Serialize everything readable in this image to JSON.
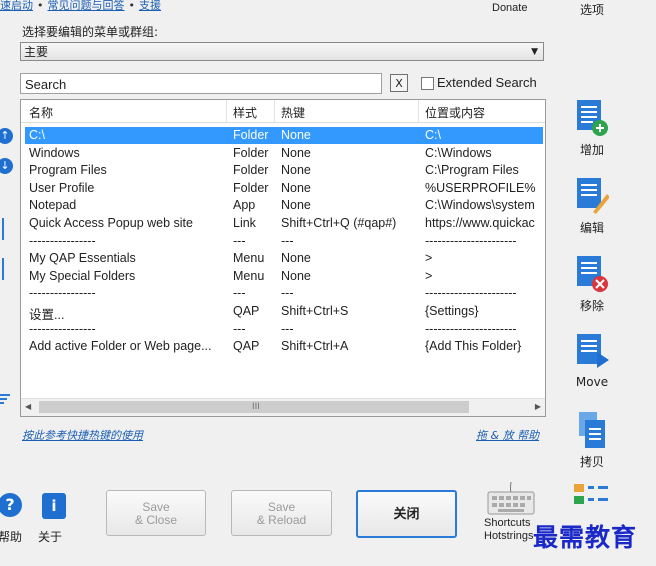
{
  "top_links": {
    "quick_start": "速启动",
    "faq": "常见问题与回答",
    "support": "支援",
    "separator": "•"
  },
  "donate_label": "Donate",
  "options_label": "选项",
  "menu_selector": {
    "label": "选择要编辑的菜单或群组:",
    "value": "主要"
  },
  "search": {
    "value": "Search",
    "clear_label": "X",
    "extended_label": "Extended Search",
    "extended_checked": false
  },
  "list": {
    "headers": [
      "名称",
      "样式",
      "热键",
      "位置或内容"
    ],
    "rows": [
      {
        "name": "C:\\",
        "type": "Folder",
        "hotkey": "None",
        "location": "C:\\",
        "selected": true
      },
      {
        "name": "Windows",
        "type": "Folder",
        "hotkey": "None",
        "location": "C:\\Windows"
      },
      {
        "name": "Program Files",
        "type": "Folder",
        "hotkey": "None",
        "location": "C:\\Program Files"
      },
      {
        "name": "User Profile",
        "type": "Folder",
        "hotkey": "None",
        "location": "%USERPROFILE%"
      },
      {
        "name": "Notepad",
        "type": "App",
        "hotkey": "None",
        "location": "C:\\Windows\\system"
      },
      {
        "name": "Quick Access Popup web site",
        "type": "Link",
        "hotkey": "Shift+Ctrl+Q (#qap#)",
        "location": "https://www.quickac"
      },
      {
        "name": "----------------",
        "type": "---",
        "hotkey": "---",
        "location": "----------------------"
      },
      {
        "name": "My QAP Essentials",
        "type": "Menu",
        "hotkey": "None",
        "location": ">"
      },
      {
        "name": "My Special Folders",
        "type": "Menu",
        "hotkey": "None",
        "location": ">"
      },
      {
        "name": "----------------",
        "type": "---",
        "hotkey": "---",
        "location": "----------------------"
      },
      {
        "name": "设置...",
        "type": "QAP",
        "hotkey": "Shift+Ctrl+S",
        "location": "{Settings}"
      },
      {
        "name": "----------------",
        "type": "---",
        "hotkey": "---",
        "location": "----------------------"
      },
      {
        "name": "Add active Folder or Web page...",
        "type": "QAP",
        "hotkey": "Shift+Ctrl+A",
        "location": "{Add This Folder}"
      }
    ],
    "scroll_grip": "III"
  },
  "help_links": {
    "left": "按此参考快捷热键的使用",
    "right": "拖 & 放 帮助"
  },
  "right_tools": [
    {
      "label": "增加",
      "icon": "add-icon"
    },
    {
      "label": "编辑",
      "icon": "edit-icon"
    },
    {
      "label": "移除",
      "icon": "remove-icon"
    },
    {
      "label": "Move",
      "icon": "move-icon"
    },
    {
      "label": "拷贝",
      "icon": "copy-icon"
    }
  ],
  "bottom": {
    "help_label": "帮助",
    "about_label": "关于",
    "save_close": "Save\n& Close",
    "save_reload": "Save\n& Reload",
    "close": "关闭",
    "shortcuts": "Shortcuts\nHotstrings"
  },
  "watermark": "最需教育",
  "colors": {
    "accent": "#3399ff",
    "link": "#1a5fb4",
    "icon_blue": "#1f6fd1"
  }
}
